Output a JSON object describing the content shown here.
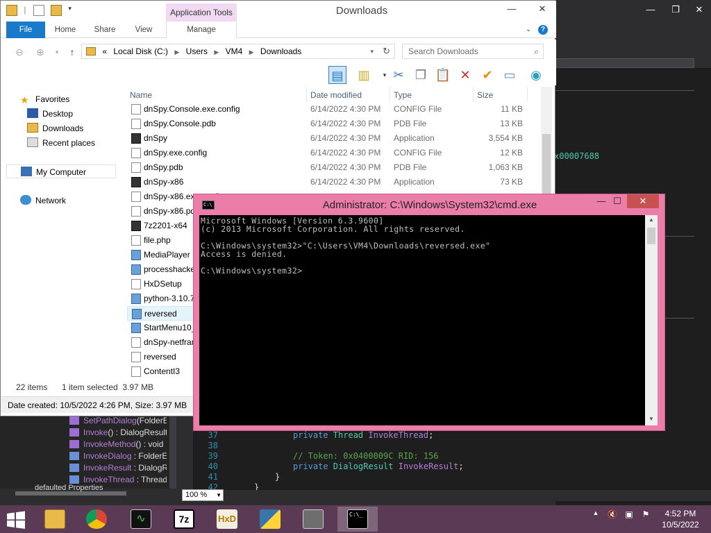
{
  "dnspy": {
    "hex_value": "x00007688",
    "tree_items": [
      {
        "name": "SetPathDialog",
        "rest": "(FolderE",
        "kind": "method"
      },
      {
        "name": "Invoke",
        "rest": "() : DialogResult",
        "kind": "method"
      },
      {
        "name": "InvokeMethod",
        "rest": "() : void",
        "kind": "method"
      },
      {
        "name": "InvokeDialog",
        "rest": " : FolderE",
        "kind": "prop"
      },
      {
        "name": "InvokeResult",
        "rest": " : DialogR",
        "kind": "prop"
      },
      {
        "name": "InvokeThread",
        "rest": " : Thread",
        "kind": "prop"
      }
    ],
    "tree_last": "defaulted Properties",
    "code_lines": [
      {
        "num": "37",
        "tokens": [
          [
            "kw",
            "private "
          ],
          [
            "ty",
            "Thread "
          ],
          [
            "pr",
            "InvokeThread"
          ],
          [
            "pl",
            ";"
          ]
        ]
      },
      {
        "num": "38",
        "tokens": []
      },
      {
        "num": "39",
        "tokens": [
          [
            "cm",
            "// Token: 0x0400009C RID: 156"
          ]
        ]
      },
      {
        "num": "40",
        "tokens": [
          [
            "kw",
            "private "
          ],
          [
            "ty",
            "DialogResult "
          ],
          [
            "pr",
            "InvokeResult"
          ],
          [
            "pl",
            ";"
          ]
        ]
      },
      {
        "num": "41",
        "tokens": [
          [
            "pl",
            "}"
          ]
        ]
      },
      {
        "num": "42",
        "tokens": [
          [
            "pl",
            "}"
          ]
        ]
      }
    ],
    "zoom": "100 %"
  },
  "explorer": {
    "title": "Downloads",
    "app_tools_label": "Application Tools",
    "tabs": [
      "File",
      "Home",
      "Share",
      "View",
      "Manage"
    ],
    "address": {
      "prefix": "«",
      "crumbs": [
        "Local Disk (C:)",
        "Users",
        "VM4",
        "Downloads"
      ]
    },
    "search_placeholder": "Search Downloads",
    "nav": {
      "favorites": "Favorites",
      "desktop": "Desktop",
      "downloads": "Downloads",
      "recent": "Recent places",
      "computer": "My Computer",
      "network": "Network"
    },
    "columns": [
      "Name",
      "Date modified",
      "Type",
      "Size"
    ],
    "files": [
      {
        "name": "dnSpy.Console.exe.config",
        "date": "6/14/2022 4:30 PM",
        "type": "CONFIG File",
        "size": "11 KB",
        "icon": "doc"
      },
      {
        "name": "dnSpy.Console.pdb",
        "date": "6/14/2022 4:30 PM",
        "type": "PDB File",
        "size": "13 KB",
        "icon": "doc"
      },
      {
        "name": "dnSpy",
        "date": "6/14/2022 4:30 PM",
        "type": "Application",
        "size": "3,554 KB",
        "icon": "app"
      },
      {
        "name": "dnSpy.exe.config",
        "date": "6/14/2022 4:30 PM",
        "type": "CONFIG File",
        "size": "12 KB",
        "icon": "doc"
      },
      {
        "name": "dnSpy.pdb",
        "date": "6/14/2022 4:30 PM",
        "type": "PDB File",
        "size": "1,063 KB",
        "icon": "doc"
      },
      {
        "name": "dnSpy-x86",
        "date": "6/14/2022 4:30 PM",
        "type": "Application",
        "size": "73 KB",
        "icon": "app"
      },
      {
        "name": "dnSpy-x86.exe.config",
        "date": "",
        "type": "",
        "size": "",
        "icon": "doc"
      },
      {
        "name": "dnSpy-x86.pdb",
        "date": "",
        "type": "",
        "size": "",
        "icon": "doc"
      },
      {
        "name": "7z2201-x64",
        "date": "",
        "type": "",
        "size": "",
        "icon": "app"
      },
      {
        "name": "file.php",
        "date": "",
        "type": "",
        "size": "",
        "icon": "doc"
      },
      {
        "name": "MediaPlayer",
        "date": "",
        "type": "",
        "size": "",
        "icon": "img"
      },
      {
        "name": "processhacker",
        "date": "",
        "type": "",
        "size": "",
        "icon": "img"
      },
      {
        "name": "HxDSetup",
        "date": "",
        "type": "",
        "size": "",
        "icon": "doc"
      },
      {
        "name": "python-3.10.7",
        "date": "",
        "type": "",
        "size": "",
        "icon": "img"
      },
      {
        "name": "reversed",
        "date": "",
        "type": "",
        "size": "",
        "icon": "img",
        "selected": true
      },
      {
        "name": "StartMenu10_",
        "date": "",
        "type": "",
        "size": "",
        "icon": "img"
      },
      {
        "name": "dnSpy-netfran",
        "date": "",
        "type": "",
        "size": "",
        "icon": "doc"
      },
      {
        "name": "reversed",
        "date": "",
        "type": "",
        "size": "",
        "icon": "doc"
      },
      {
        "name": "ContentI3",
        "date": "",
        "type": "",
        "size": "",
        "icon": "doc"
      }
    ],
    "status_items": "22 items",
    "status_selected": "1 item selected  3.97 MB",
    "details": "Date created: 10/5/2022 4:26 PM, Size: 3.97 MB"
  },
  "cmd": {
    "title": "Administrator: C:\\Windows\\System32\\cmd.exe",
    "icon_text": "C:\\",
    "lines": [
      "Microsoft Windows [Version 6.3.9600]",
      "(c) 2013 Microsoft Corporation. All rights reserved.",
      "",
      "C:\\Windows\\system32>\"C:\\Users\\VM4\\Downloads\\reversed.exe\"",
      "Access is denied.",
      "",
      "C:\\Windows\\system32>"
    ]
  },
  "taskbar": {
    "time": "4:52 PM",
    "date": "10/5/2022",
    "apps": [
      "file-explorer",
      "chrome",
      "resource-monitor",
      "7zip",
      "hxd",
      "python",
      "task-view",
      "cmd"
    ]
  }
}
